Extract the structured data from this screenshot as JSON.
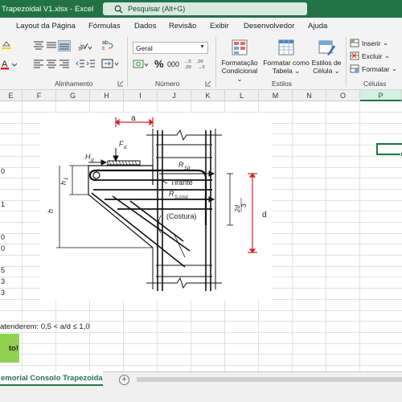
{
  "window": {
    "title": "Trapezoidal V1.xlsx  -  Excel",
    "search_placeholder": "Pesquisar (Alt+G)"
  },
  "ribbon_tabs": [
    "Layout da Página",
    "Fórmulas",
    "Dados",
    "Revisão",
    "Exibir",
    "Desenvolvedor",
    "Ajuda"
  ],
  "ribbon": {
    "groups": {
      "alignment": "Alinhamento",
      "number": "Número",
      "styles": "Estilos",
      "cells": "Células"
    },
    "number_format": "Geral",
    "percent_symbol": "%",
    "thousands_symbol": "000",
    "conditional_format": [
      "Formatação",
      "Condicional"
    ],
    "format_as_table": [
      "Formatar como",
      "Tabela"
    ],
    "cell_styles": [
      "Estilos de",
      "Célula"
    ],
    "insert": "Inserir",
    "delete": "Excluir",
    "format": "Formatar"
  },
  "columns": [
    "E",
    "F",
    "G",
    "H",
    "I",
    "J",
    "K",
    "L",
    "M",
    "N",
    "O",
    "P"
  ],
  "selected_column": "P",
  "cells": {
    "values": [
      "0",
      "1",
      "0",
      "0",
      "5",
      "3",
      "3"
    ]
  },
  "figure": {
    "labels": {
      "a": "a",
      "fd": "F",
      "fd_sub": "d",
      "hd": "H",
      "hd_sub": "d",
      "rsd": "R",
      "rsd_sub": "Sd",
      "tirante": "Tirante",
      "rs_cost": "R",
      "rs_cost_sub": "S,cost",
      "costura": "(Costura)",
      "h1": "h",
      "h1_sub": "1",
      "h": "h",
      "frac_num": "2d",
      "frac_den": "3",
      "d": "d"
    }
  },
  "note_text": "atenderem: 0,5 < a/d ≤ 1,0",
  "ok_text": "to!",
  "sheet_tab": "emorial Consolo Trapezoidal",
  "add_sheet_symbol": "+",
  "colors": {
    "excel_green": "#217346",
    "ok_fill": "#92d050",
    "dimension_red": "#d0282e"
  }
}
